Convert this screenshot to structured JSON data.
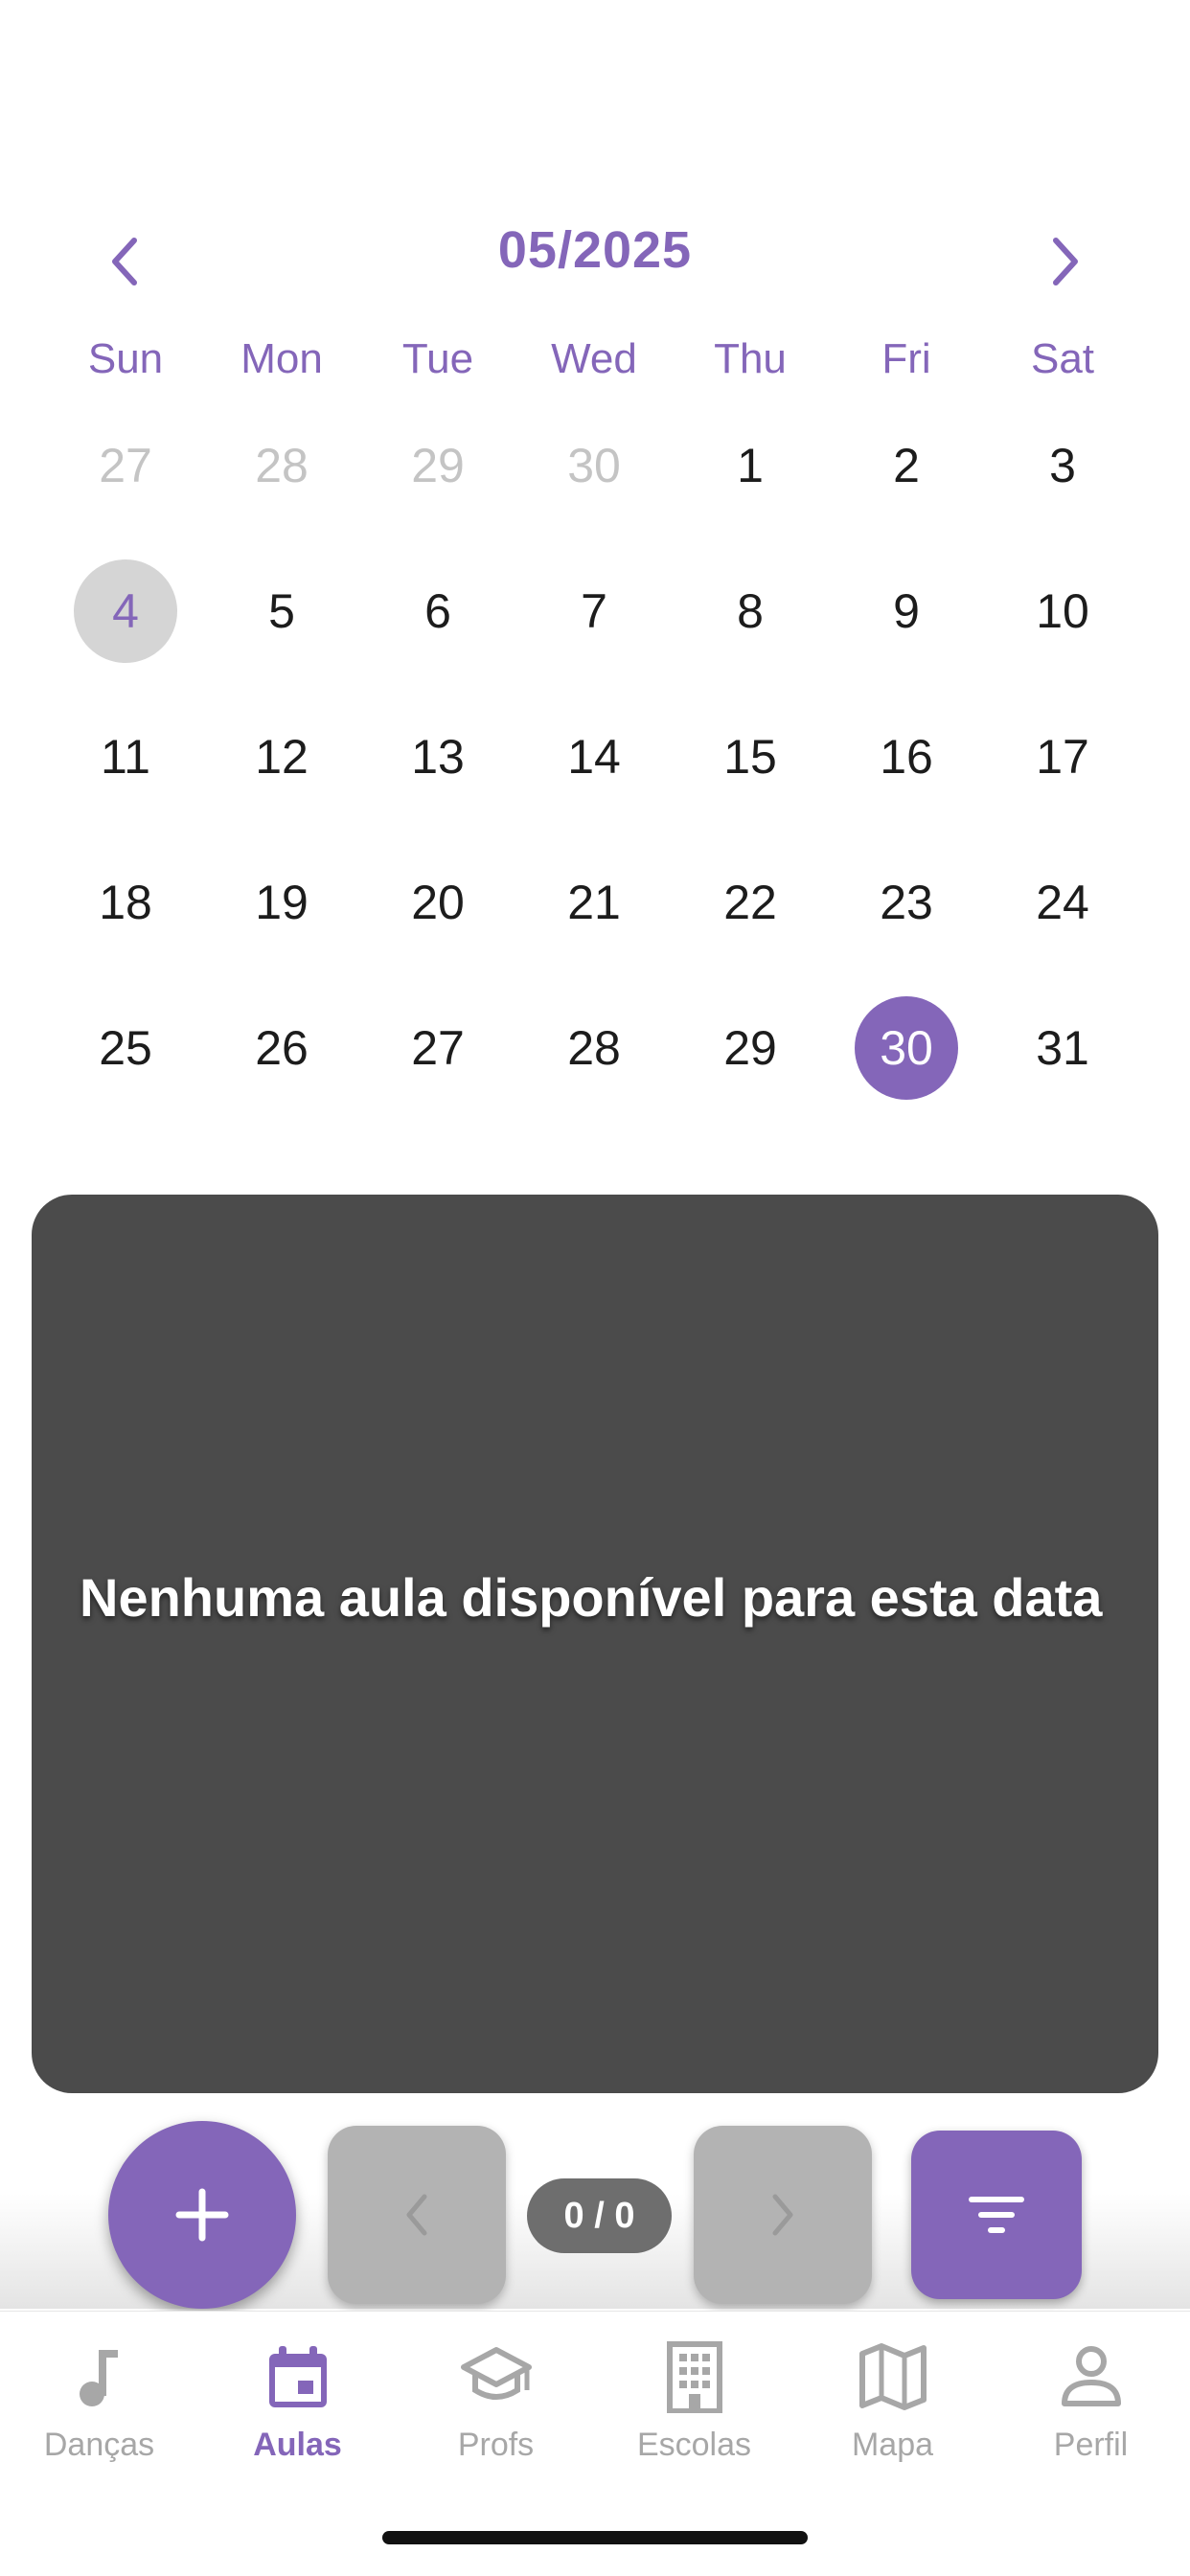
{
  "calendar": {
    "month_label": "05/2025",
    "weekdays": [
      "Sun",
      "Mon",
      "Tue",
      "Wed",
      "Thu",
      "Fri",
      "Sat"
    ],
    "weeks": [
      [
        {
          "d": "27",
          "muted": true
        },
        {
          "d": "28",
          "muted": true
        },
        {
          "d": "29",
          "muted": true
        },
        {
          "d": "30",
          "muted": true
        },
        {
          "d": "1"
        },
        {
          "d": "2"
        },
        {
          "d": "3"
        }
      ],
      [
        {
          "d": "4",
          "today": true
        },
        {
          "d": "5"
        },
        {
          "d": "6"
        },
        {
          "d": "7"
        },
        {
          "d": "8"
        },
        {
          "d": "9"
        },
        {
          "d": "10"
        }
      ],
      [
        {
          "d": "11"
        },
        {
          "d": "12"
        },
        {
          "d": "13"
        },
        {
          "d": "14"
        },
        {
          "d": "15"
        },
        {
          "d": "16"
        },
        {
          "d": "17"
        }
      ],
      [
        {
          "d": "18"
        },
        {
          "d": "19"
        },
        {
          "d": "20"
        },
        {
          "d": "21"
        },
        {
          "d": "22"
        },
        {
          "d": "23"
        },
        {
          "d": "24"
        }
      ],
      [
        {
          "d": "25"
        },
        {
          "d": "26"
        },
        {
          "d": "27"
        },
        {
          "d": "28"
        },
        {
          "d": "29"
        },
        {
          "d": "30",
          "selected": true
        },
        {
          "d": "31"
        }
      ]
    ]
  },
  "empty_state": {
    "message": "Nenhuma aula disponível para esta data"
  },
  "actions": {
    "add_icon": "plus-icon",
    "prev_icon": "chevron-left-icon",
    "next_icon": "chevron-right-icon",
    "filter_icon": "filter-icon",
    "pager_count": "0 / 0"
  },
  "nav": {
    "items": [
      {
        "label": "Danças",
        "icon": "music-note-icon",
        "active": false
      },
      {
        "label": "Aulas",
        "icon": "calendar-icon",
        "active": true
      },
      {
        "label": "Profs",
        "icon": "graduation-cap-icon",
        "active": false
      },
      {
        "label": "Escolas",
        "icon": "building-icon",
        "active": false
      },
      {
        "label": "Mapa",
        "icon": "map-icon",
        "active": false
      },
      {
        "label": "Perfil",
        "icon": "person-icon",
        "active": false
      }
    ]
  },
  "colors": {
    "accent": "#8466b9",
    "today_bg": "#d5d5d5",
    "card_bg": "#4b4b4b",
    "muted_text": "#c4c4c4",
    "disabled_btn": "#b3b3b3",
    "nav_inactive": "#a7a7a7"
  }
}
